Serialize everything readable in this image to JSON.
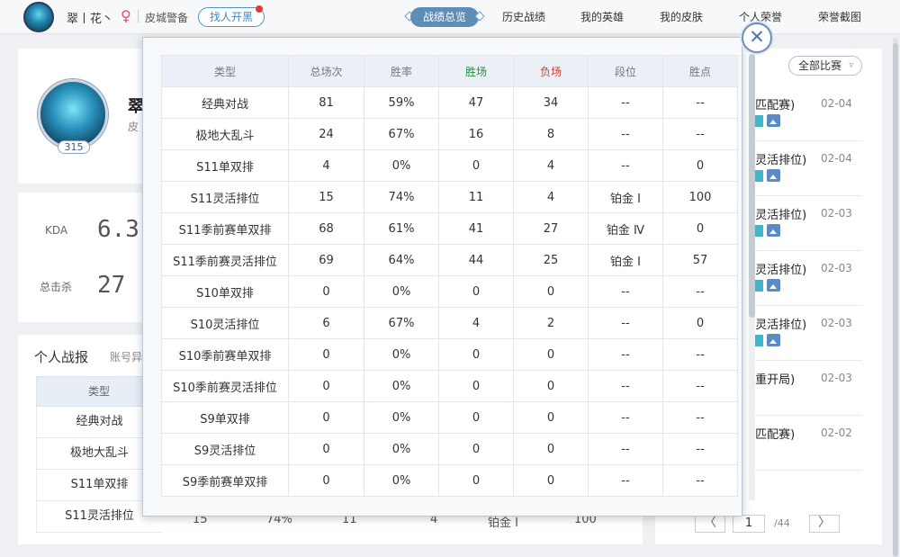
{
  "topbar": {
    "username": "翠丨花丶",
    "gender_symbol": "♀",
    "server": "皮城警备",
    "find_button": "找人开黑",
    "nav": [
      "战绩总览",
      "历史战绩",
      "我的英雄",
      "我的皮肤",
      "个人荣誉",
      "荣誉截图"
    ]
  },
  "profile": {
    "name_partial": "翠",
    "server_partial": "皮",
    "level": "315"
  },
  "stats": {
    "kda_label": "KDA",
    "kda_value": "6.3",
    "kills_label": "总击杀",
    "kills_value": "27"
  },
  "report": {
    "title": "个人战报",
    "subtitle_partial": "账号异",
    "col_type": "类型",
    "rows": [
      "经典对战",
      "极地大乱斗",
      "S11单双排",
      "S11灵活排位"
    ],
    "partial_last": [
      "15",
      "74%",
      "11",
      "4",
      "铂金 Ⅰ",
      "100"
    ]
  },
  "matches": {
    "filter": "全部比赛",
    "filter_arrow": "▿",
    "items": [
      {
        "title": "(匹配赛)",
        "date": "02-04",
        "tags": true
      },
      {
        "title": "(灵活排位)",
        "date": "02-04",
        "tags": true
      },
      {
        "title": "(灵活排位)",
        "date": "02-03",
        "tags": true
      },
      {
        "title": "(灵活排位)",
        "date": "02-03",
        "tags": true
      },
      {
        "title": "(灵活排位)",
        "date": "02-03",
        "tags": true
      },
      {
        "title": "(重开局)",
        "date": "02-03",
        "tags": false
      },
      {
        "title": "(匹配赛)",
        "date": "02-02",
        "tags": false
      }
    ],
    "pager": {
      "prev": "〈",
      "current": "1",
      "total": "/44",
      "next": "〉"
    }
  },
  "modal": {
    "close_symbol": "✕",
    "headers": [
      "类型",
      "总场次",
      "胜率",
      "胜场",
      "负场",
      "段位",
      "胜点"
    ],
    "rows": [
      [
        "经典对战",
        "81",
        "59%",
        "47",
        "34",
        "--",
        "--"
      ],
      [
        "极地大乱斗",
        "24",
        "67%",
        "16",
        "8",
        "--",
        "--"
      ],
      [
        "S11单双排",
        "4",
        "0%",
        "0",
        "4",
        "--",
        "0"
      ],
      [
        "S11灵活排位",
        "15",
        "74%",
        "11",
        "4",
        "铂金 Ⅰ",
        "100"
      ],
      [
        "S11季前赛单双排",
        "68",
        "61%",
        "41",
        "27",
        "铂金 Ⅳ",
        "0"
      ],
      [
        "S11季前赛灵活排位",
        "69",
        "64%",
        "44",
        "25",
        "铂金 Ⅰ",
        "57"
      ],
      [
        "S10单双排",
        "0",
        "0%",
        "0",
        "0",
        "--",
        "--"
      ],
      [
        "S10灵活排位",
        "6",
        "67%",
        "4",
        "2",
        "--",
        "0"
      ],
      [
        "S10季前赛单双排",
        "0",
        "0%",
        "0",
        "0",
        "--",
        "--"
      ],
      [
        "S10季前赛灵活排位",
        "0",
        "0%",
        "0",
        "0",
        "--",
        "--"
      ],
      [
        "S9单双排",
        "0",
        "0%",
        "0",
        "0",
        "--",
        "--"
      ],
      [
        "S9灵活排位",
        "0",
        "0%",
        "0",
        "0",
        "--",
        "--"
      ],
      [
        "S9季前赛单双排",
        "0",
        "0%",
        "0",
        "0",
        "--",
        "--"
      ]
    ]
  },
  "colors": {
    "accent": "#5e8db5",
    "win": "#2e8b3e",
    "loss": "#d23a3a",
    "header_bg": "#eaf0f6"
  }
}
